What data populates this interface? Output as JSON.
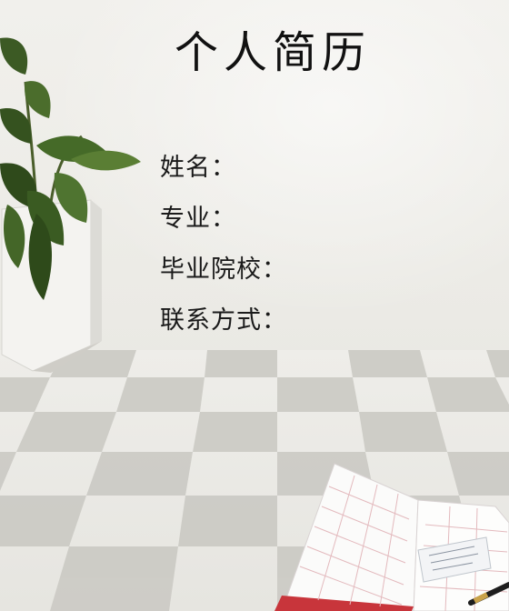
{
  "resume": {
    "title": "个人简历",
    "fields": {
      "name": "姓名：",
      "major": "专业：",
      "school": "毕业院校：",
      "contact": "联系方式："
    }
  },
  "illustrations": {
    "plant": "potted-plant",
    "floor": "checkered-floor",
    "planner": "open-planner-with-pen"
  }
}
